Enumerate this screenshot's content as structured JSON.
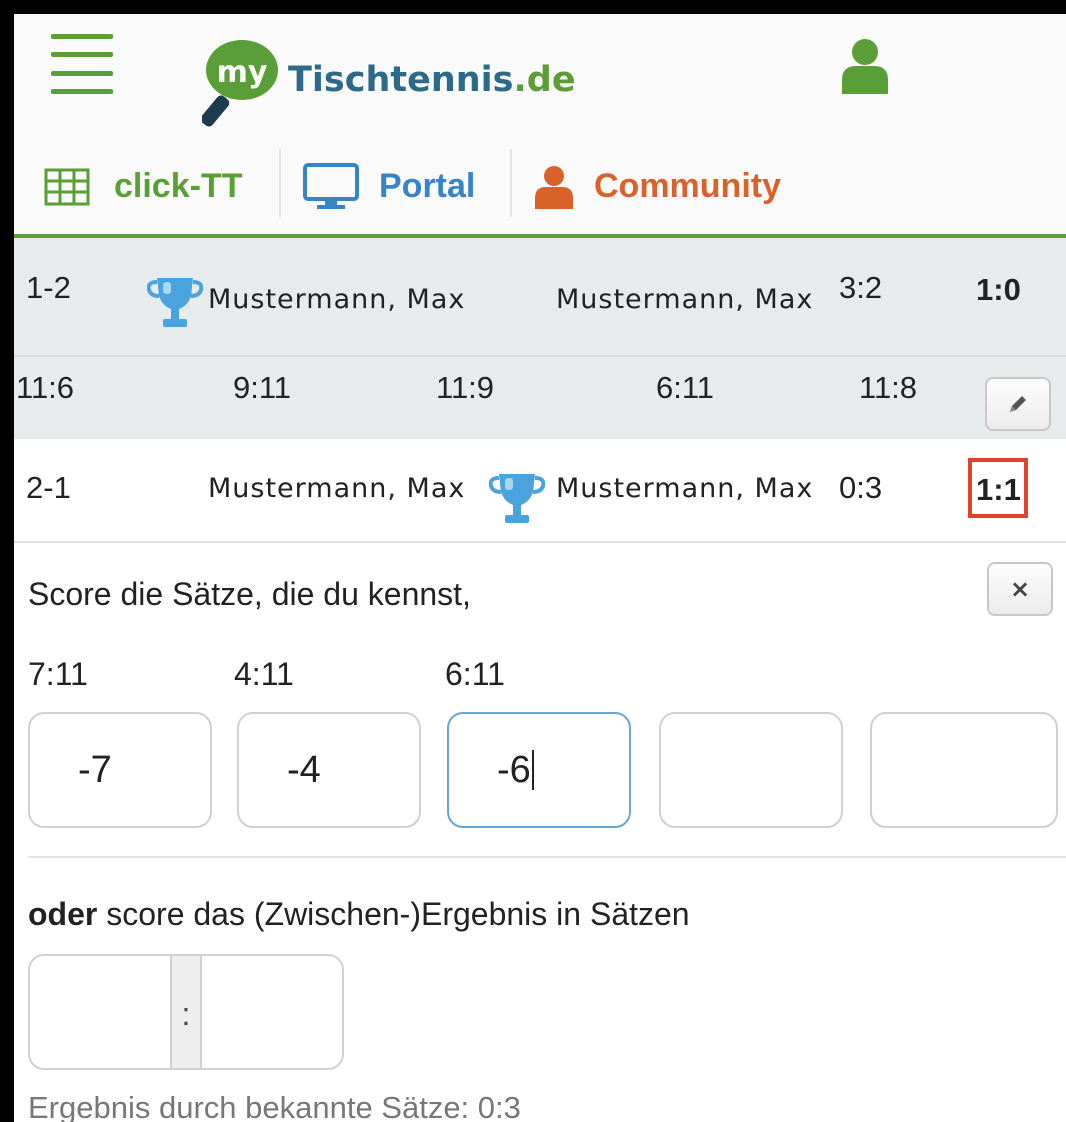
{
  "header": {
    "logo_my": "my",
    "logo_name": "Tischtennis",
    "logo_tld": ".de"
  },
  "nav": {
    "clicktt": "click-TT",
    "portal": "Portal",
    "community": "Community"
  },
  "colors": {
    "green": "#5a9e37",
    "blue": "#3784c9",
    "orange": "#d9622b",
    "highlight": "#e0422a"
  },
  "matches": [
    {
      "pairing": "1-2",
      "player_left": "Mustermann, Max",
      "player_right": "Mustermann, Max",
      "sets": "3:2",
      "total": "1:0",
      "winner": "left"
    },
    {
      "pairing": "2-1",
      "player_left": "Mustermann, Max",
      "player_right": "Mustermann, Max",
      "sets": "0:3",
      "total": "1:1",
      "winner": "right"
    }
  ],
  "set_scores": [
    "11:6",
    "9:11",
    "11:9",
    "6:11",
    "11:8"
  ],
  "entry": {
    "prompt": "Score die Sätze, die du kennst,",
    "close_label": "×",
    "set_labels": [
      "7:11",
      "4:11",
      "6:11"
    ],
    "set_inputs": [
      "-7",
      "-4",
      "-6",
      "",
      ""
    ],
    "or_bold": "oder",
    "or_text": " score das (Zwischen-)Ergebnis in Sätzen",
    "result_separator": ":",
    "known_result": "Ergebnis durch bekannte Sätze: 0:3"
  }
}
